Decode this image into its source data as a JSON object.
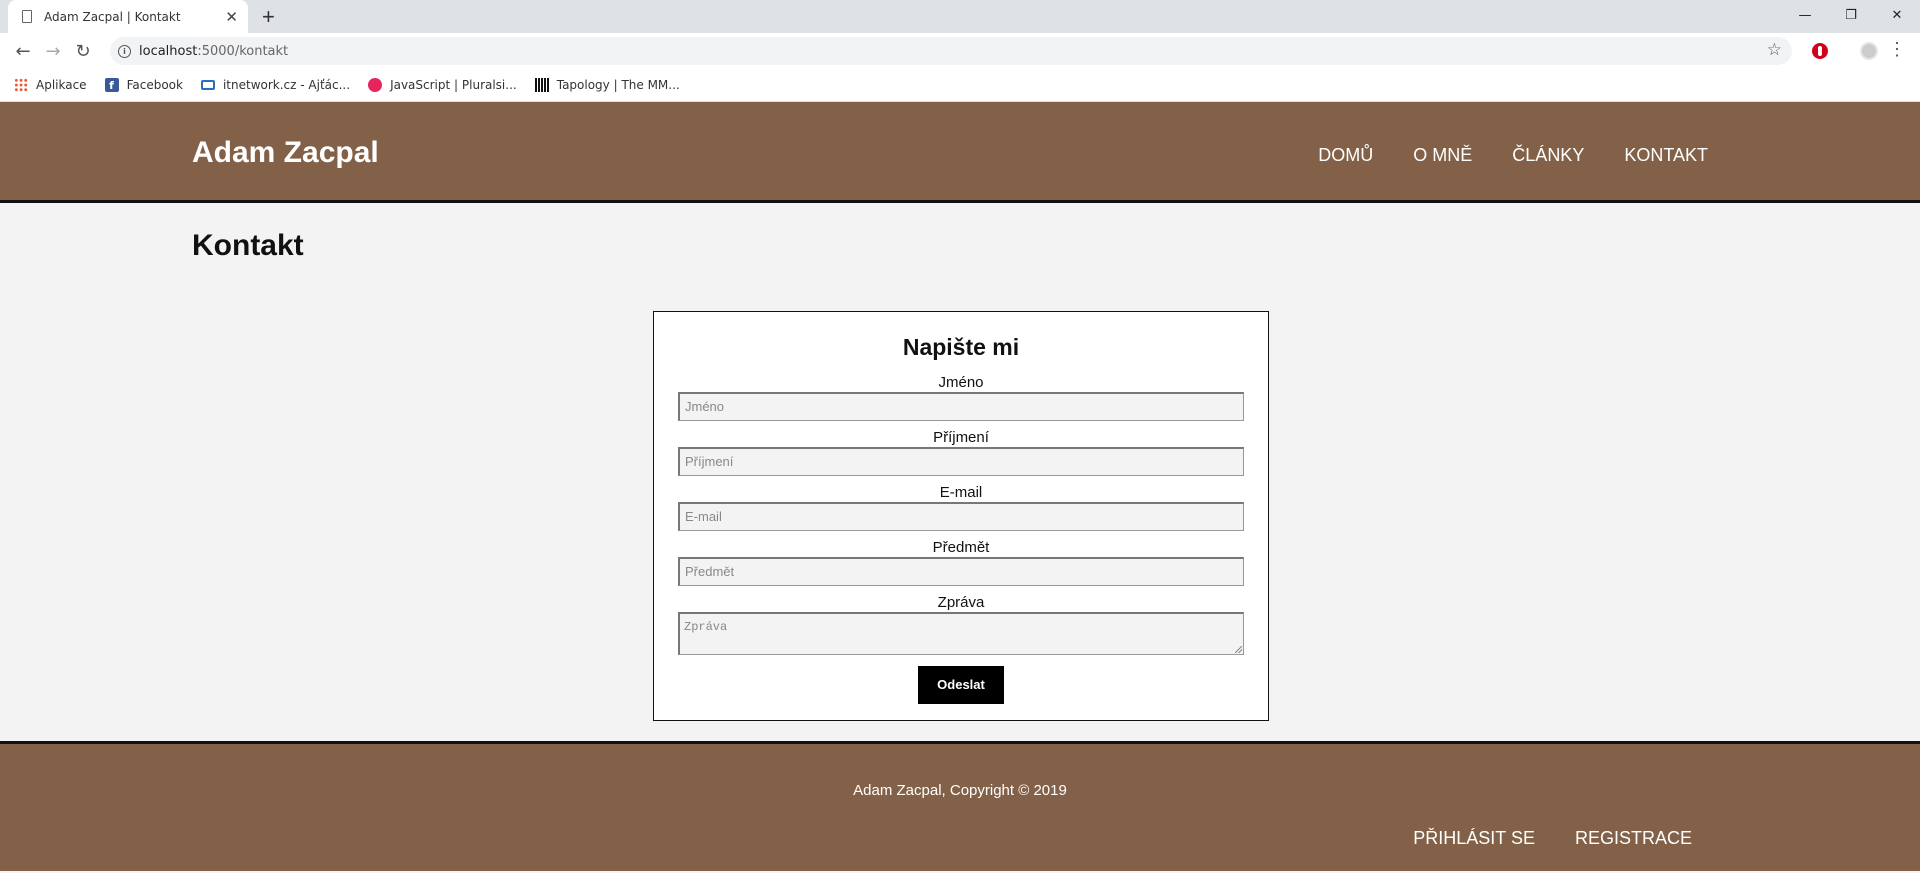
{
  "browser": {
    "tab_title": "Adam Zacpal | Kontakt",
    "tab_close": "✕",
    "new_tab": "+",
    "url_host": "localhost",
    "url_path": ":5000/kontakt",
    "window_controls": {
      "minimize": "—",
      "restore": "❐",
      "close": "✕"
    },
    "bookmarks": [
      {
        "label": "Aplikace",
        "icon": "apps-icon"
      },
      {
        "label": "Facebook",
        "icon": "facebook-icon"
      },
      {
        "label": "itnetwork.cz - Ajťác...",
        "icon": "laptop-icon"
      },
      {
        "label": "JavaScript | Pluralsi...",
        "icon": "pluralsight-icon"
      },
      {
        "label": "Tapology | The MM...",
        "icon": "tapology-icon"
      }
    ]
  },
  "header": {
    "brand": "Adam Zacpal",
    "nav": [
      "DOMŮ",
      "O MNĚ",
      "ČLÁNKY",
      "KONTAKT"
    ]
  },
  "main": {
    "page_title": "Kontakt",
    "form": {
      "title": "Napište mi",
      "fields": [
        {
          "label": "Jméno",
          "placeholder": "Jméno"
        },
        {
          "label": "Příjmení",
          "placeholder": "Příjmení"
        },
        {
          "label": "E-mail",
          "placeholder": "E-mail"
        },
        {
          "label": "Předmět",
          "placeholder": "Předmět"
        }
      ],
      "message": {
        "label": "Zpráva",
        "placeholder": "Zpráva"
      },
      "submit_label": "Odeslat"
    }
  },
  "footer": {
    "copyright": "Adam Zacpal, Copyright © 2019",
    "links": [
      "PŘIHLÁSIT SE",
      "REGISTRACE"
    ]
  },
  "colors": {
    "brand_brown": "#836148",
    "page_bg": "#f3f3f3",
    "button_black": "#000000"
  }
}
